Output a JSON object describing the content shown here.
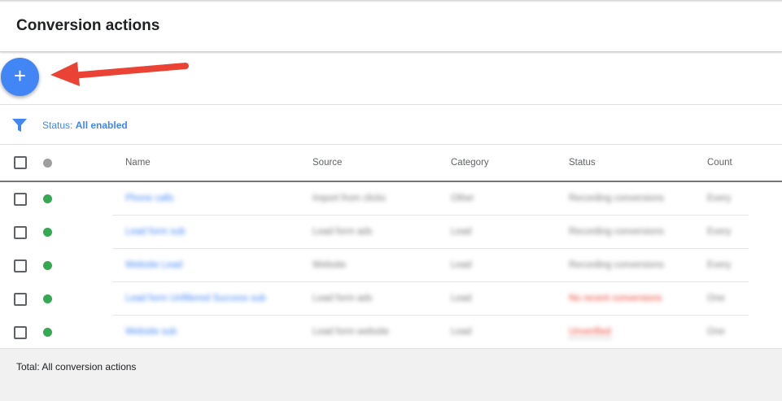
{
  "header": {
    "title": "Conversion actions"
  },
  "fab": {
    "label": "+"
  },
  "filter": {
    "prefix": "Status:",
    "value": "All enabled"
  },
  "table": {
    "columns": [
      "Name",
      "Source",
      "Category",
      "Status",
      "Count"
    ],
    "rows": [
      {
        "name": "Phone calls",
        "source": "Import from clicks",
        "category": "Other",
        "status": "Recording conversions",
        "count": "Every"
      },
      {
        "name": "Lead form sub",
        "source": "Lead form ads",
        "category": "Lead",
        "status": "Recording conversions",
        "count": "Every"
      },
      {
        "name": "Website Lead",
        "source": "Website",
        "category": "Lead",
        "status": "Recording conversions",
        "count": "Every"
      },
      {
        "name": "Lead form Unfiltered Success sub",
        "source": "Lead form ads",
        "category": "Lead",
        "status": "No recent conversions",
        "count": "One"
      },
      {
        "name": "Website sub",
        "source": "Lead form website",
        "category": "Lead",
        "status": "Unverified",
        "count": "One"
      }
    ]
  },
  "footer": {
    "total": "Total: All conversion actions"
  },
  "colors": {
    "accent": "#4285f4",
    "enabled": "#34a853",
    "error": "#ea4335",
    "arrow": "#ea4335"
  },
  "icons": {
    "filter": "filter-icon",
    "add": "plus-icon",
    "arrow": "arrow-left-icon"
  }
}
